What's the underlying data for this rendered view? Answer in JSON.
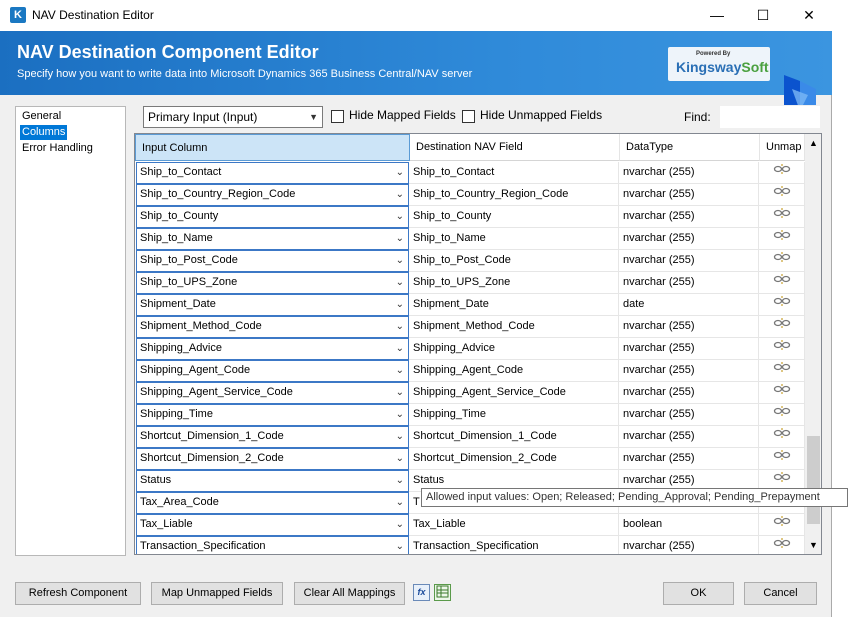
{
  "window": {
    "title": "NAV Destination Editor",
    "minimize": "—",
    "maximize": "☐",
    "close": "✕"
  },
  "header": {
    "title": "NAV Destination Component Editor",
    "subtitle": "Specify how you want to write data into Microsoft Dynamics 365 Business Central/NAV server",
    "logo_powered": "Powered By",
    "logo_kingsway": "Kingsway",
    "logo_soft": "Soft"
  },
  "nav": {
    "items": [
      {
        "label": "General"
      },
      {
        "label": "Columns"
      },
      {
        "label": "Error Handling"
      }
    ]
  },
  "toolbar": {
    "input_select": "Primary Input (Input)",
    "hide_mapped": "Hide Mapped Fields",
    "hide_unmapped": "Hide Unmapped Fields",
    "find_label": "Find:",
    "find_value": ""
  },
  "grid": {
    "headers": {
      "input": "Input Column",
      "dest": "Destination NAV Field",
      "dtype": "DataType",
      "unmap": "Unmap"
    },
    "rows": [
      {
        "input": "Ship_to_Contact",
        "dest": "Ship_to_Contact",
        "dtype": "nvarchar (255)"
      },
      {
        "input": "Ship_to_Country_Region_Code",
        "dest": "Ship_to_Country_Region_Code",
        "dtype": "nvarchar (255)"
      },
      {
        "input": "Ship_to_County",
        "dest": "Ship_to_County",
        "dtype": "nvarchar (255)"
      },
      {
        "input": "Ship_to_Name",
        "dest": "Ship_to_Name",
        "dtype": "nvarchar (255)"
      },
      {
        "input": "Ship_to_Post_Code",
        "dest": "Ship_to_Post_Code",
        "dtype": "nvarchar (255)"
      },
      {
        "input": "Ship_to_UPS_Zone",
        "dest": "Ship_to_UPS_Zone",
        "dtype": "nvarchar (255)"
      },
      {
        "input": "Shipment_Date",
        "dest": "Shipment_Date",
        "dtype": "date"
      },
      {
        "input": "Shipment_Method_Code",
        "dest": "Shipment_Method_Code",
        "dtype": "nvarchar (255)"
      },
      {
        "input": "Shipping_Advice",
        "dest": "Shipping_Advice",
        "dtype": "nvarchar (255)"
      },
      {
        "input": "Shipping_Agent_Code",
        "dest": "Shipping_Agent_Code",
        "dtype": "nvarchar (255)"
      },
      {
        "input": "Shipping_Agent_Service_Code",
        "dest": "Shipping_Agent_Service_Code",
        "dtype": "nvarchar (255)"
      },
      {
        "input": "Shipping_Time",
        "dest": "Shipping_Time",
        "dtype": "nvarchar (255)"
      },
      {
        "input": "Shortcut_Dimension_1_Code",
        "dest": "Shortcut_Dimension_1_Code",
        "dtype": "nvarchar (255)"
      },
      {
        "input": "Shortcut_Dimension_2_Code",
        "dest": "Shortcut_Dimension_2_Code",
        "dtype": "nvarchar (255)"
      },
      {
        "input": "Status",
        "dest": "Status",
        "dtype": "nvarchar (255)"
      },
      {
        "input": "Tax_Area_Code",
        "dest": "T",
        "dtype": ""
      },
      {
        "input": "Tax_Liable",
        "dest": "Tax_Liable",
        "dtype": "boolean"
      },
      {
        "input": "Transaction_Specification",
        "dest": "Transaction_Specification",
        "dtype": "nvarchar (255)"
      }
    ],
    "unmap_icon": "unlink-icon"
  },
  "tooltip": "Allowed input values: Open; Released; Pending_Approval; Pending_Prepayment",
  "buttons": {
    "refresh": "Refresh Component",
    "map_unmapped": "Map Unmapped Fields",
    "clear_all": "Clear All Mappings",
    "expr_icon": "fx",
    "ok": "OK",
    "cancel": "Cancel"
  },
  "colors": {
    "header_blue": "#1b6fc1",
    "selection_blue": "#0078d7",
    "column_header_sel": "#cce4f7"
  }
}
